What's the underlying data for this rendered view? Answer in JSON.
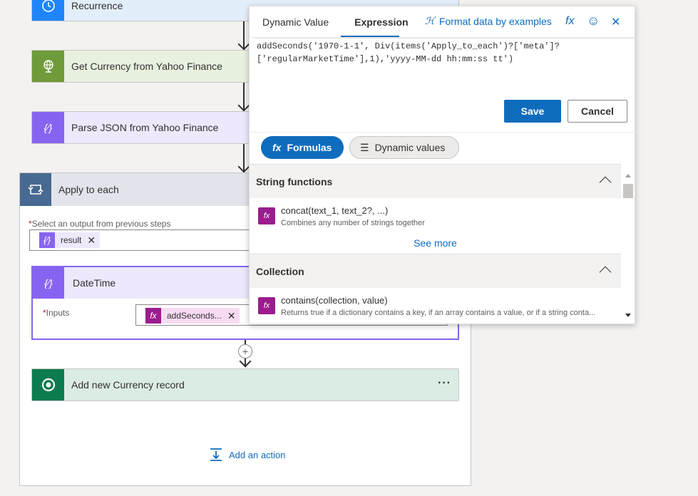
{
  "flow": {
    "steps": [
      {
        "title": "Recurrence",
        "color": "#1f85ff",
        "icon": "clock-icon"
      },
      {
        "title": "Get Currency from Yahoo Finance",
        "color": "#6f9b3a",
        "icon": "globe-icon"
      },
      {
        "title": "Parse JSON from Yahoo Finance",
        "color": "#8764f0",
        "icon": "data-operation-icon"
      }
    ],
    "apply_each": {
      "title": "Apply to each",
      "select_label": "Select an output from previous steps",
      "required_marker": "*",
      "token": "result"
    },
    "datetime": {
      "title": "DateTime",
      "inputs_label": "Inputs",
      "required_marker": "*",
      "token": "addSeconds..."
    },
    "add_record": {
      "title": "Add new Currency record",
      "menu": "···"
    },
    "add_action": "Add an action"
  },
  "popup": {
    "tabs": [
      "Dynamic Value",
      "Expression"
    ],
    "active_tab": "Expression",
    "format_link": "Format data by examples",
    "expression_lines": [
      "addSeconds('1970-1-1', Div(items('Apply_to_each')?['meta']?",
      "['regularMarketTime'],1),'yyyy-MM-dd hh:mm:ss tt')"
    ],
    "save_label": "Save",
    "cancel_label": "Cancel",
    "pills": {
      "formulas": "Formulas",
      "dynamic": "Dynamic values"
    },
    "sections": [
      {
        "title": "String functions",
        "functions": [
          {
            "name": "concat(text_1, text_2?, ...)",
            "desc": "Combines any number of strings together"
          }
        ],
        "see_more": "See more"
      },
      {
        "title": "Collection",
        "functions": [
          {
            "name": "contains(collection, value)",
            "desc": "Returns true if a dictionary contains a key, if an array contains a value, or if a string conta..."
          }
        ]
      }
    ]
  },
  "colors": {
    "accent": "#0f6cbd",
    "function_icon": "#9b1c8e",
    "datetime": "#8764f0",
    "dataverse": "#0c7c4e",
    "apply_each": "#486991"
  }
}
